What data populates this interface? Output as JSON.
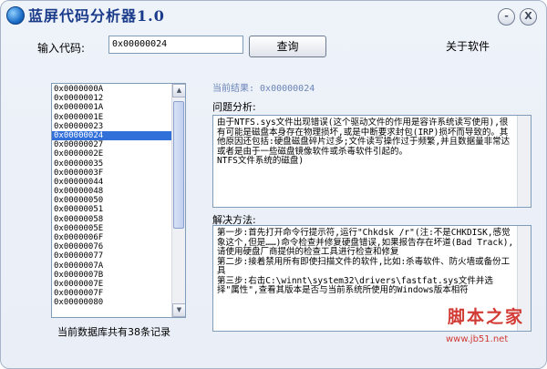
{
  "window": {
    "title": "蓝屏代码分析器1.0",
    "min_label": "-",
    "close_label": "X"
  },
  "toolbar": {
    "code_label": "输入代码:",
    "code_value": "0x00000024",
    "query_label": "查询",
    "about_label": "关于软件"
  },
  "code_list": {
    "items": [
      "0x0000000A",
      "0x00000012",
      "0x0000001A",
      "0x0000001E",
      "0x00000023",
      "0x00000024",
      "0x00000027",
      "0x0000002E",
      "0x00000035",
      "0x0000003F",
      "0x00000044",
      "0x00000048",
      "0x00000050",
      "0x00000051",
      "0x00000058",
      "0x0000005E",
      "0x0000006F",
      "0x00000076",
      "0x00000077",
      "0x0000007A",
      "0x0000007B",
      "0x0000007E",
      "0x0000007F",
      "0x00000080"
    ],
    "selected_index": 5,
    "record_count": "当前数据库共有38条记录"
  },
  "result": {
    "current": "当前结果: 0x00000024",
    "problem_label": "问题分析:",
    "problem_text": "由于NTFS.sys文件出现错误(这个驱动文件的作用是容许系统读写使用),很有可能是磁盘本身存在物理损坏,或是中断要求封包(IRP)损坏而导致的。其他原因还包括:硬盘磁盘碎片过多;文件读写操作过于频繁,并且数据量非常达或者是由于一些磁盘镜像软件或杀毒软件引起的。\nNTFS文件系统的磁盘)",
    "solution_label": "解决方法:",
    "solution_text": "第一步:首先打开命令行提示符,运行\"Chkdsk /r\"(注:不是CHKDISK,感觉象这个,但是……)命令检查并修复硬盘错误,如果报告存在坏道(Bad Track),请使用硬盘厂商提供的检查工具进行检查和修复\n第二步:接着禁用所有即使扫描文件的软件,比如:杀毒软件、防火墙或备份工具\n第三步:右击C:\\winnt\\system32\\drivers\\fastfat.sys文件并选择\"属性\",查看其版本是否与当前系统所使用的Windows版本相符"
  },
  "watermark": {
    "text": "脚本之家",
    "url": "www.jb51.net"
  }
}
